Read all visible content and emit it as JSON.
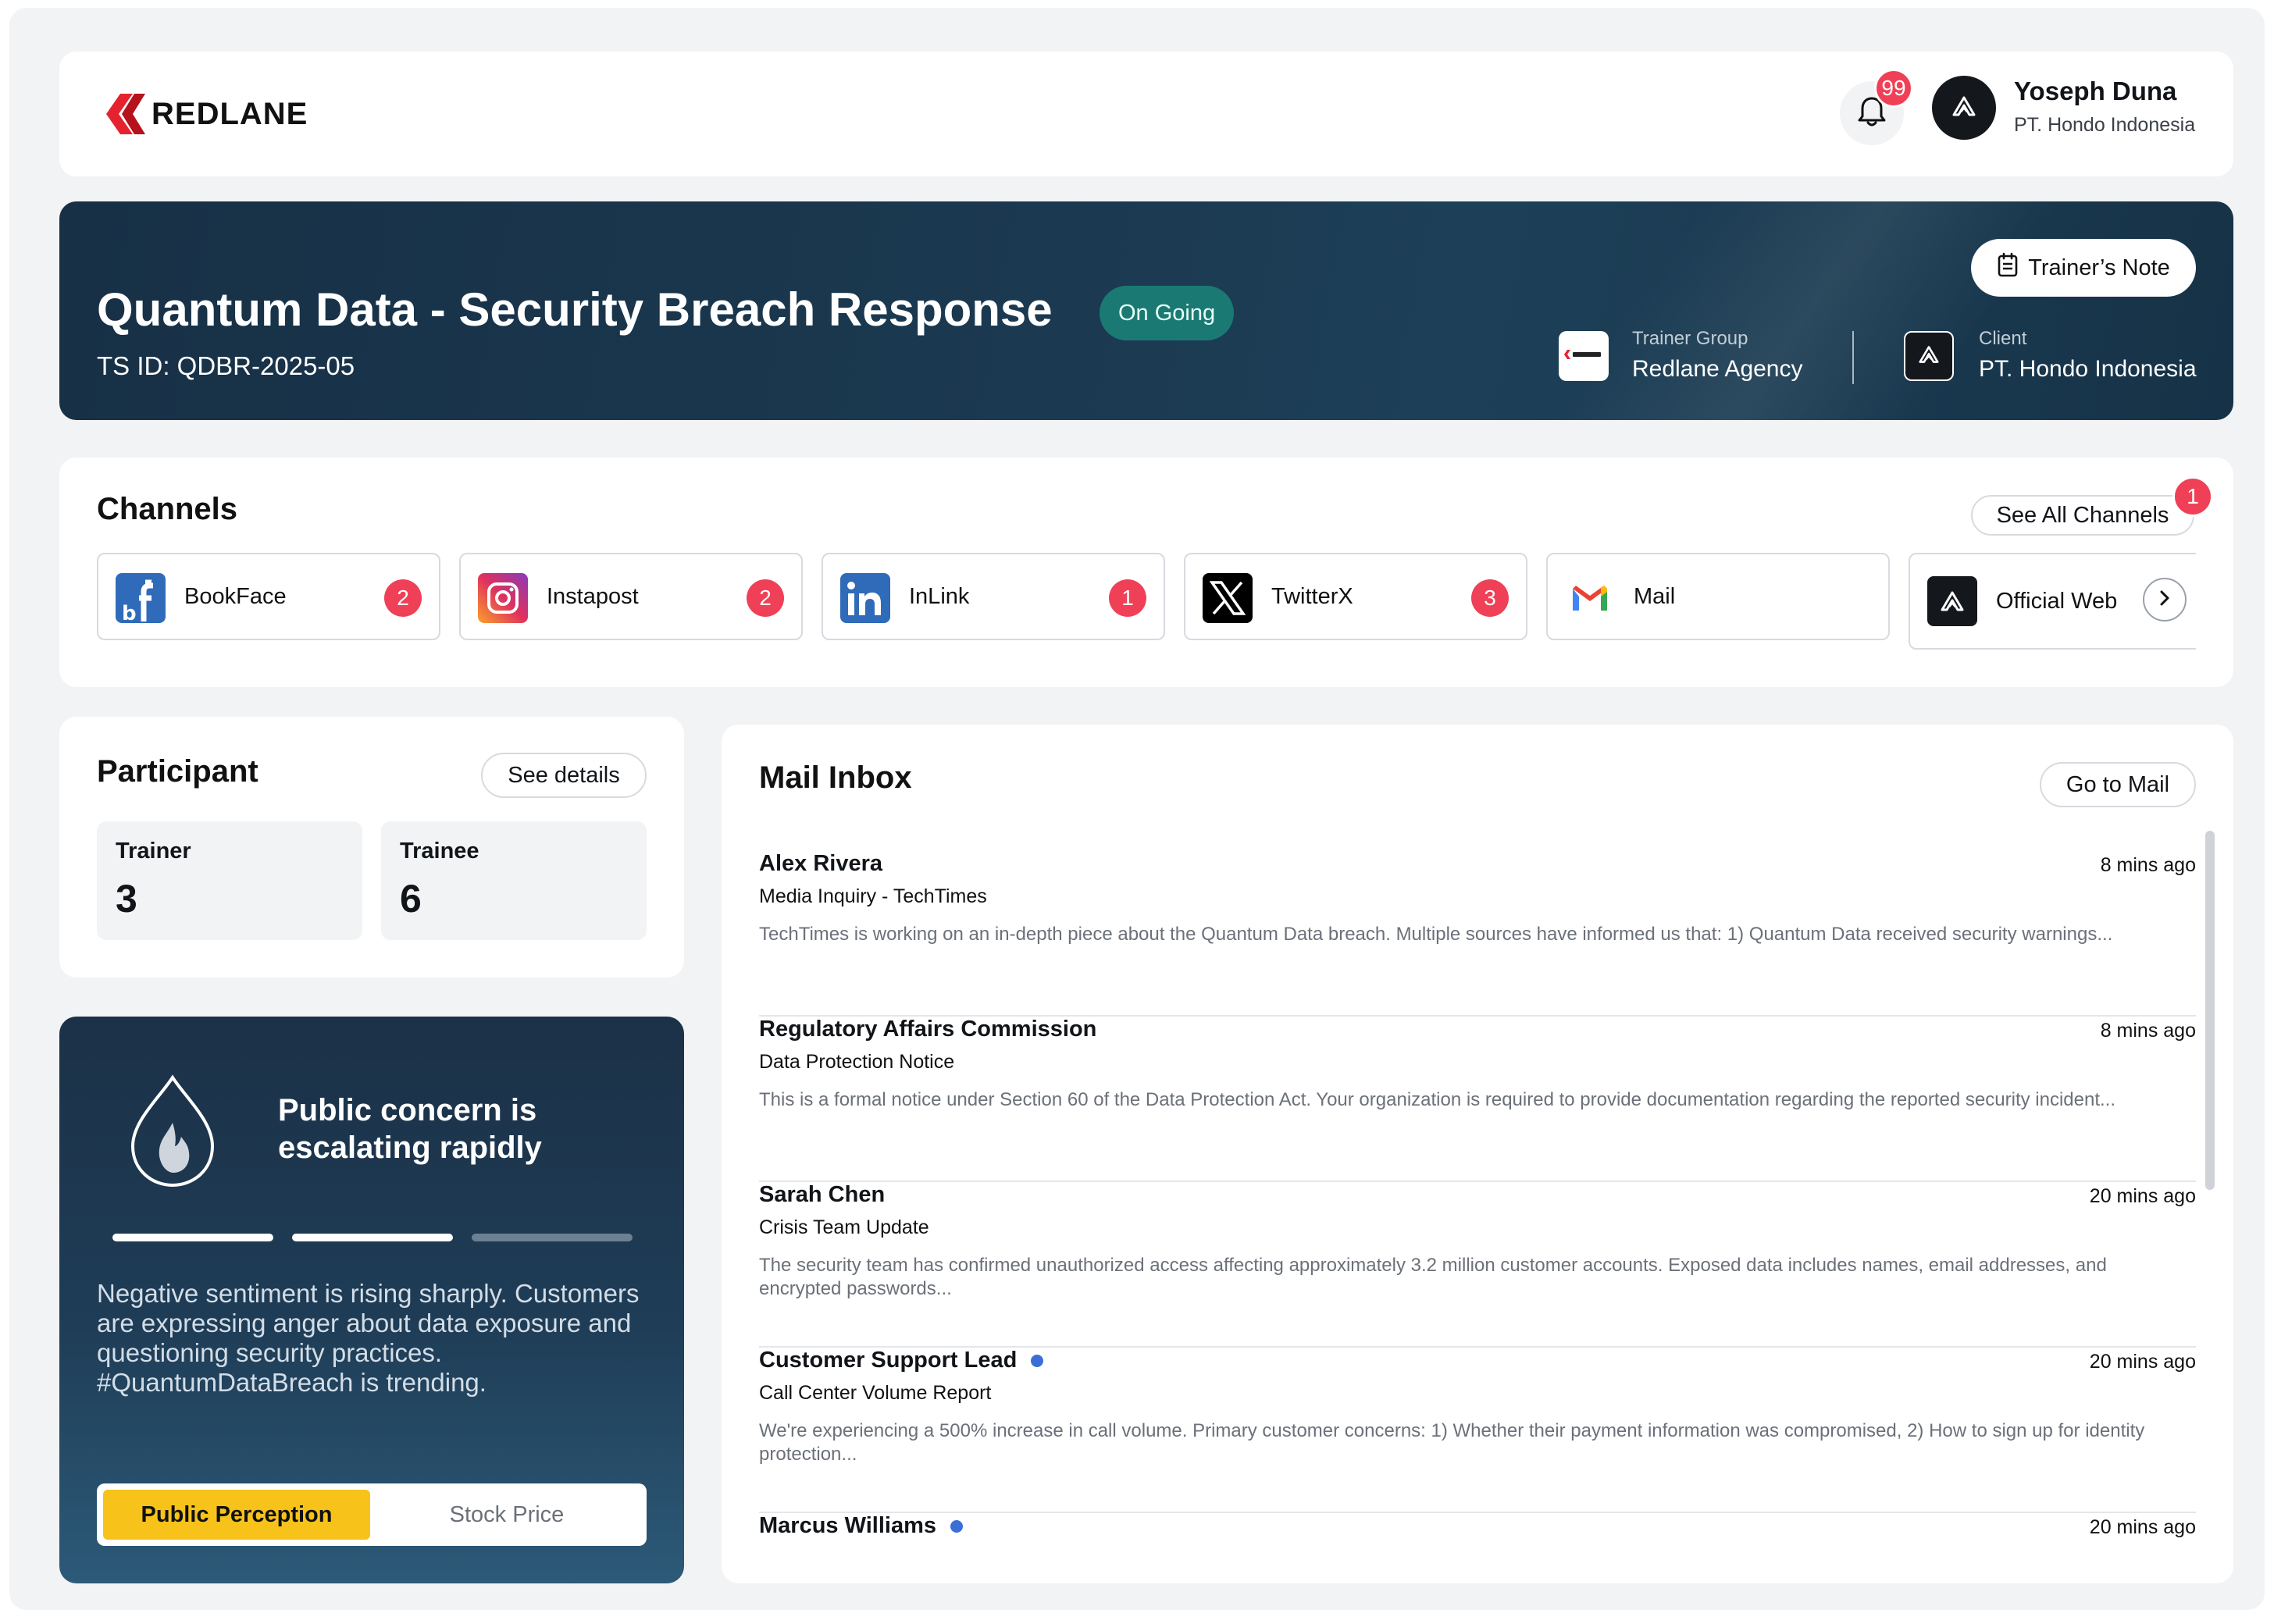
{
  "header": {
    "brand": "REDLANE",
    "notifications_count": "99",
    "user_name": "Yoseph Duna",
    "user_org": "PT. Hondo Indonesia"
  },
  "hero": {
    "title": "Quantum Data - Security Breach Response",
    "ts_id": "TS ID: QDBR-2025-05",
    "status": "On Going",
    "trainers_note": "Trainer’s Note",
    "trainer_group_label": "Trainer Group",
    "trainer_group_value": "Redlane Agency",
    "client_label": "Client",
    "client_value": "PT. Hondo Indonesia"
  },
  "channels": {
    "title": "Channels",
    "see_all": "See All Channels",
    "see_all_badge": "1",
    "items": [
      {
        "label": "BookFace",
        "badge": "2",
        "icon": "bookface-icon"
      },
      {
        "label": "Instapost",
        "badge": "2",
        "icon": "instapost-icon"
      },
      {
        "label": "InLink",
        "badge": "1",
        "icon": "inlink-icon"
      },
      {
        "label": "TwitterX",
        "badge": "3",
        "icon": "twitterx-icon"
      },
      {
        "label": "Mail",
        "badge": "",
        "icon": "mail-icon"
      },
      {
        "label": "Official Web",
        "badge": "",
        "icon": "official-web-icon"
      }
    ]
  },
  "participant": {
    "title": "Participant",
    "see_details": "See details",
    "trainer_label": "Trainer",
    "trainer_value": "3",
    "trainee_label": "Trainee",
    "trainee_value": "6"
  },
  "alert": {
    "title": "Public concern is escalating rapidly",
    "text": "Negative sentiment is rising sharply. Customers are expressing anger about data exposure and questioning security practices. #QuantumDataBreach is trending.",
    "progress_steps_filled": 2,
    "progress_steps_total": 3,
    "tab_active": "Public Perception",
    "tab_inactive": "Stock Price"
  },
  "mail": {
    "title": "Mail Inbox",
    "go_to_mail": "Go to Mail",
    "items": [
      {
        "from": "Alex Rivera",
        "subject": "Media Inquiry - TechTimes",
        "time": "8 mins ago",
        "unread": false,
        "preview": "TechTimes is working on an in-depth piece about the Quantum Data breach. Multiple sources have informed us that: 1) Quantum Data received security warnings..."
      },
      {
        "from": "Regulatory Affairs Commission",
        "subject": "Data Protection Notice",
        "time": "8 mins ago",
        "unread": false,
        "preview": "This is a formal notice under Section 60 of the Data Protection Act. Your organization is required to provide documentation regarding the reported security incident..."
      },
      {
        "from": "Sarah Chen",
        "subject": "Crisis Team Update",
        "time": "20 mins ago",
        "unread": false,
        "preview": "The security team has confirmed unauthorized access affecting approximately 3.2 million customer accounts. Exposed data includes names, email addresses, and encrypted passwords..."
      },
      {
        "from": "Customer Support Lead",
        "subject": "Call Center Volume Report",
        "time": "20 mins ago",
        "unread": true,
        "preview": "We're experiencing a 500% increase in call volume. Primary customer concerns: 1) Whether their payment information was compromised, 2) How to sign up for identity protection..."
      },
      {
        "from": "Marcus Williams",
        "subject": "",
        "time": "20 mins ago",
        "unread": true,
        "preview": ""
      }
    ]
  },
  "colors": {
    "accent_red": "#ef4057",
    "status_teal": "#1a7a73",
    "tab_yellow": "#f7c31b",
    "hero_navy": "#1b3950",
    "unread_blue": "#3b6fd6"
  }
}
